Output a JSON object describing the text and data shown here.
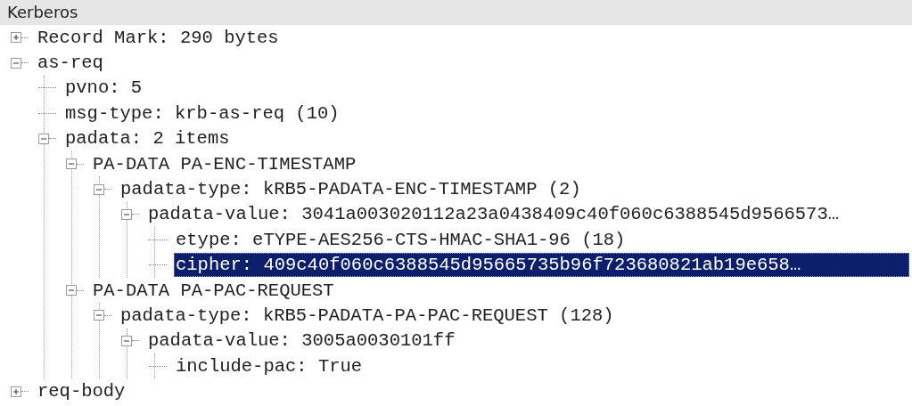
{
  "panel": {
    "title": "Kerberos"
  },
  "tree": [
    {
      "label": "Record Mark: 290 bytes",
      "expanded": false,
      "selected": false
    },
    {
      "label": "as-req",
      "expanded": true,
      "selected": false,
      "children": [
        {
          "label": "pvno: 5",
          "selected": false
        },
        {
          "label": "msg-type: krb-as-req (10)",
          "selected": false
        },
        {
          "label": "padata: 2 items",
          "expanded": true,
          "selected": false,
          "children": [
            {
              "label": "PA-DATA PA-ENC-TIMESTAMP",
              "expanded": true,
              "selected": false,
              "children": [
                {
                  "label": "padata-type: kRB5-PADATA-ENC-TIMESTAMP (2)",
                  "expanded": true,
                  "selected": false,
                  "children": [
                    {
                      "label": "padata-value: 3041a003020112a23a0438409c40f060c6388545d9566573…",
                      "expanded": true,
                      "selected": false,
                      "children": [
                        {
                          "label": "etype: eTYPE-AES256-CTS-HMAC-SHA1-96 (18)",
                          "selected": false
                        },
                        {
                          "label": "cipher: 409c40f060c6388545d95665735b96f723680821ab19e658…",
                          "selected": true
                        }
                      ]
                    }
                  ]
                }
              ]
            },
            {
              "label": "PA-DATA PA-PAC-REQUEST",
              "expanded": true,
              "selected": false,
              "children": [
                {
                  "label": "padata-type: kRB5-PADATA-PA-PAC-REQUEST (128)",
                  "expanded": true,
                  "selected": false,
                  "children": [
                    {
                      "label": "padata-value: 3005a0030101ff",
                      "expanded": true,
                      "selected": false,
                      "children": [
                        {
                          "label": "include-pac: True",
                          "selected": false
                        }
                      ]
                    }
                  ]
                }
              ]
            }
          ]
        }
      ]
    },
    {
      "label": "req-body",
      "expanded": false,
      "selected": false
    }
  ]
}
